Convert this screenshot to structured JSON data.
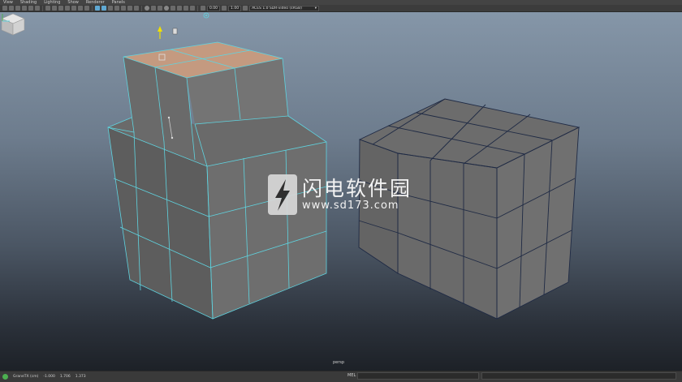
{
  "menubar": {
    "items": [
      "View",
      "Shading",
      "Lighting",
      "Show",
      "Renderer",
      "Panels"
    ]
  },
  "toolbar": {
    "field1": "0.00",
    "field2": "1.00",
    "colorspace": "ACES 1.0 SDR-video (sRGB)"
  },
  "viewport": {
    "camera": "persp",
    "background_top": "#8596a8",
    "background_bottom": "#1d2127",
    "mesh_color": "#6b6b6b",
    "selected_face_color": "#c49a80",
    "wire_selected": "#5fd4e0",
    "wire_default": "#1f2a44"
  },
  "watermark": {
    "title": "闪电软件园",
    "url": "www.sd173.com"
  },
  "statusbar": {
    "object_name": "GraneTX (cm)",
    "x": "-1.000",
    "y": "1.706",
    "z": "1.373",
    "mel_label": "MEL"
  },
  "icons": {
    "viewcube": "viewcube-icon",
    "axis": "axis-gizmo-icon",
    "manipulator": "move-manipulator-icon"
  }
}
